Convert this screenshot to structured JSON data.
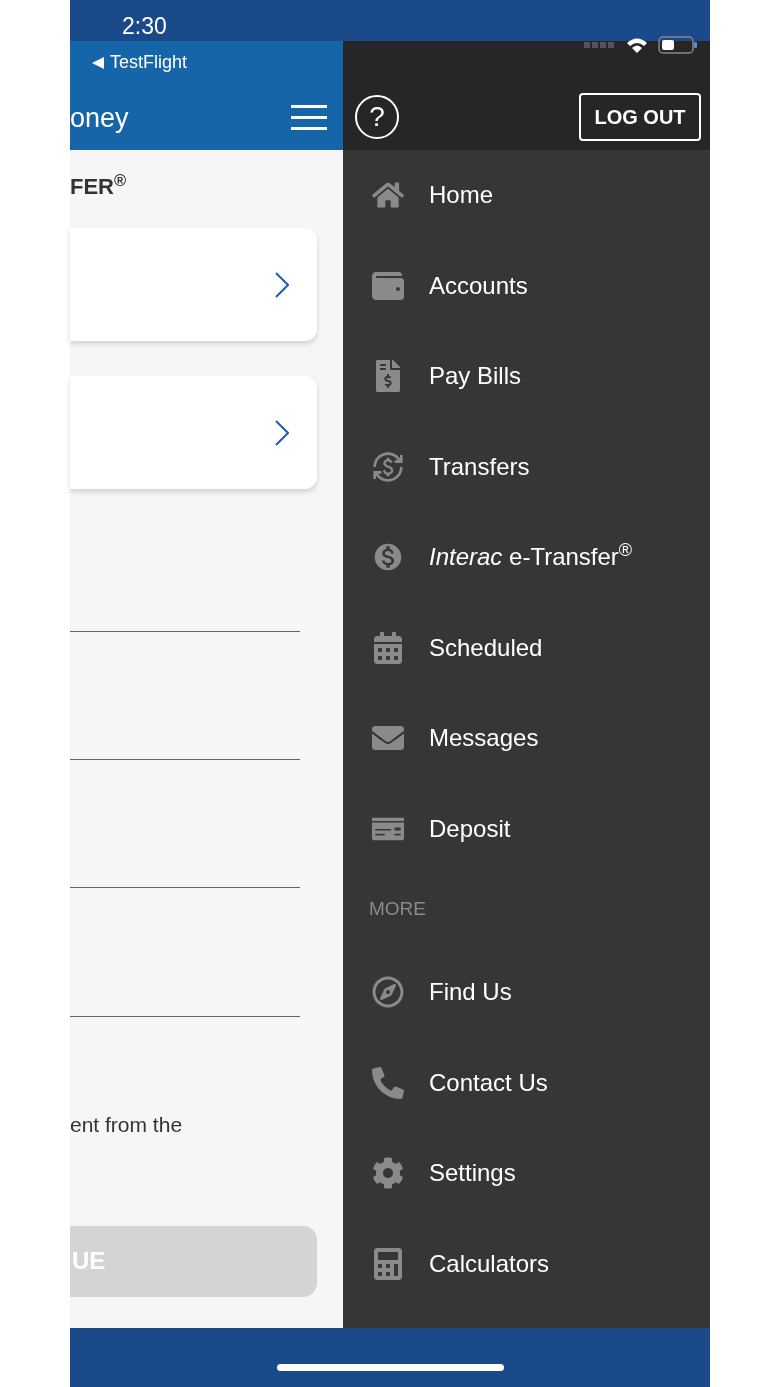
{
  "status_bar": {
    "time": "2:30",
    "back_label": "TestFlight"
  },
  "header": {
    "title": "oney"
  },
  "page": {
    "section_title": "FER$^{®}$",
    "note": "ent from the",
    "continue_button": {
      "label": "UE",
      "disabled": true
    }
  },
  "drawer": {
    "help": "?",
    "logout_label": "LOG OUT",
    "items": [
      {
        "label": "Home"
      },
      {
        "label": "Accounts"
      },
      {
        "label": "Pay Bills"
      },
      {
        "label": "Transfers"
      },
      {
        "label": "*Interac* e-Transfer$^{®}$"
      },
      {
        "label": "Scheduled"
      },
      {
        "label": "Messages"
      },
      {
        "label": "Deposit"
      }
    ],
    "more_heading": "MORE",
    "more_items": [
      {
        "label": "Find Us"
      },
      {
        "label": "Contact Us"
      },
      {
        "label": "Settings"
      },
      {
        "label": "Calculators"
      }
    ]
  }
}
